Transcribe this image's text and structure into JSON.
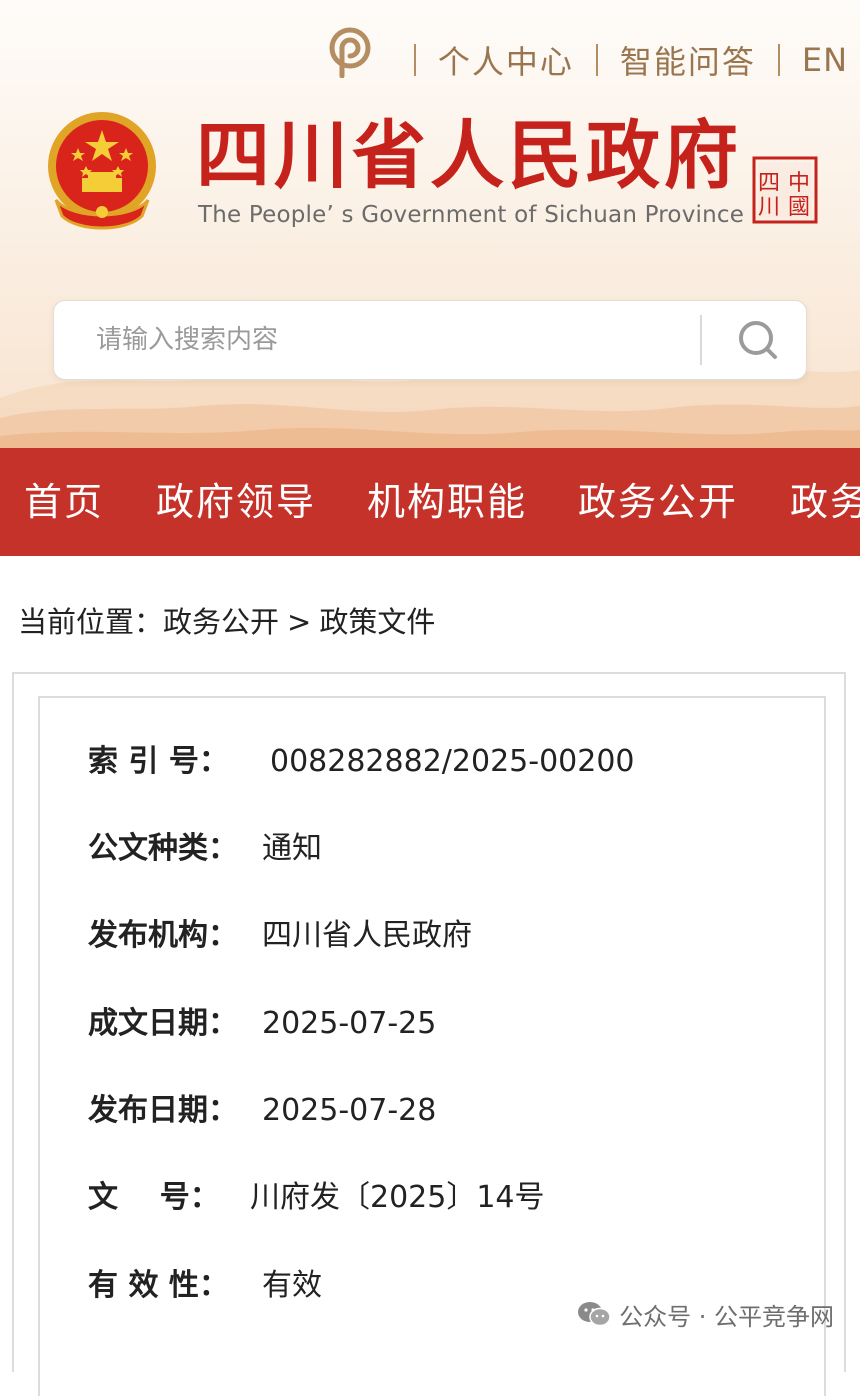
{
  "header": {
    "top_links": [
      {
        "label": "个人中心"
      },
      {
        "label": "智能问答"
      },
      {
        "label": "EN"
      }
    ],
    "title": "四川省人民政府",
    "subtitle": "The People’ s Government of Sichuan Province",
    "seal_text": "四川 中國"
  },
  "search": {
    "placeholder": "请输入搜索内容",
    "value": ""
  },
  "nav": {
    "items": [
      {
        "label": "首页"
      },
      {
        "label": "政府领导"
      },
      {
        "label": "机构职能"
      },
      {
        "label": "政务公开"
      },
      {
        "label": "政务"
      }
    ]
  },
  "breadcrumb": {
    "prefix": "当前位置：",
    "items": [
      "政务公开",
      "政策文件"
    ],
    "separator": ">"
  },
  "document_meta": {
    "rows": [
      {
        "label": "索 引 号：",
        "value": "008282882/2025-00200"
      },
      {
        "label": "公文种类：",
        "value": "通知"
      },
      {
        "label": "发布机构：",
        "value": "四川省人民政府"
      },
      {
        "label": "成文日期：",
        "value": "2025-07-25"
      },
      {
        "label": "发布日期：",
        "value": "2025-07-28"
      },
      {
        "label": "文    号：",
        "value": "川府发〔2025〕14号"
      },
      {
        "label": "有 效 性：",
        "value": "有效"
      }
    ]
  },
  "watermark": {
    "text": "公众号 · 公平竞争网"
  },
  "colors": {
    "brand_red": "#c6221c",
    "nav_red": "#c5322a",
    "top_link_brown": "#9a7650"
  }
}
